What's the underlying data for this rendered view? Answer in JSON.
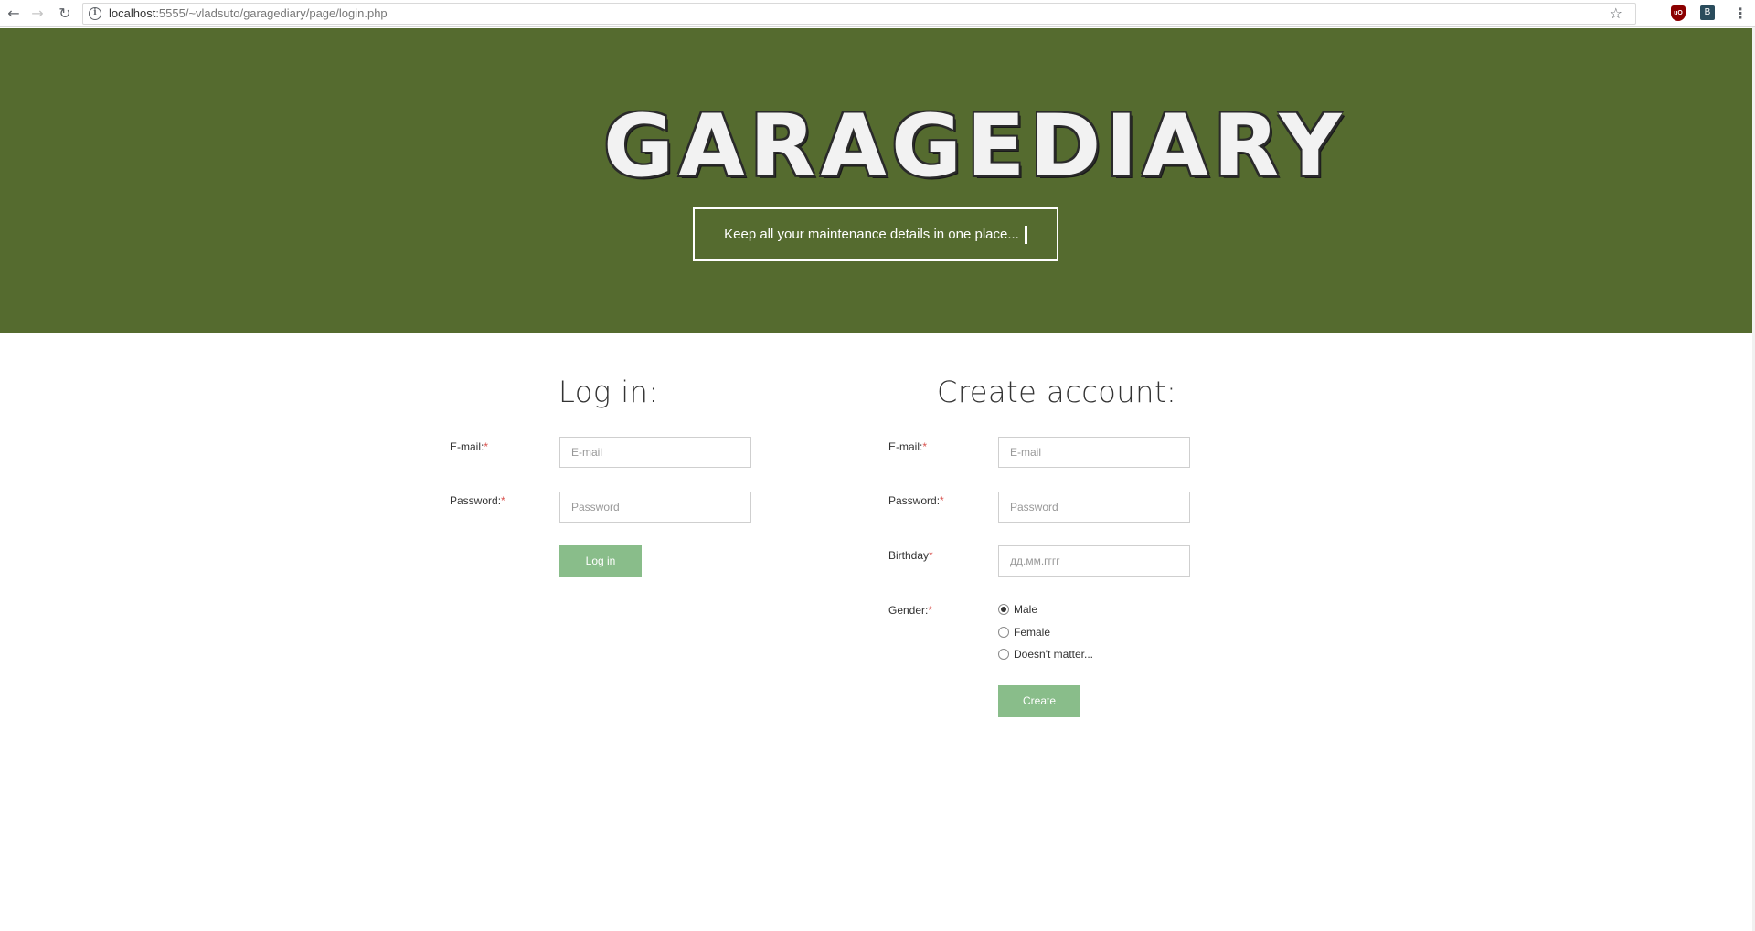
{
  "browser": {
    "url_host": "localhost",
    "url_rest": ":5555/~vladsuto/garagediary/page/login.php",
    "extensions": {
      "ublock_label": "uO",
      "other_label": "B"
    }
  },
  "colors": {
    "hero_bg": "#556b2f",
    "button_bg": "#89bd8a",
    "required": "#d9534f"
  },
  "hero": {
    "logo": "GARAGEDIARY",
    "tagline": "Keep all your maintenance details in one place..."
  },
  "login": {
    "title": "Log in:",
    "email_label": "E-mail:",
    "email_placeholder": "E-mail",
    "password_label": "Password:",
    "password_placeholder": "Password",
    "submit_label": "Log in"
  },
  "register": {
    "title": "Create account:",
    "email_label": "E-mail:",
    "email_placeholder": "E-mail",
    "password_label": "Password:",
    "password_placeholder": "Password",
    "birthday_label": "Birthday",
    "birthday_placeholder": "дд.мм.гггг",
    "gender_label": "Gender:",
    "gender_options": [
      "Male",
      "Female",
      "Doesn't matter..."
    ],
    "gender_selected": "Male",
    "submit_label": "Create"
  },
  "required_mark": "*"
}
